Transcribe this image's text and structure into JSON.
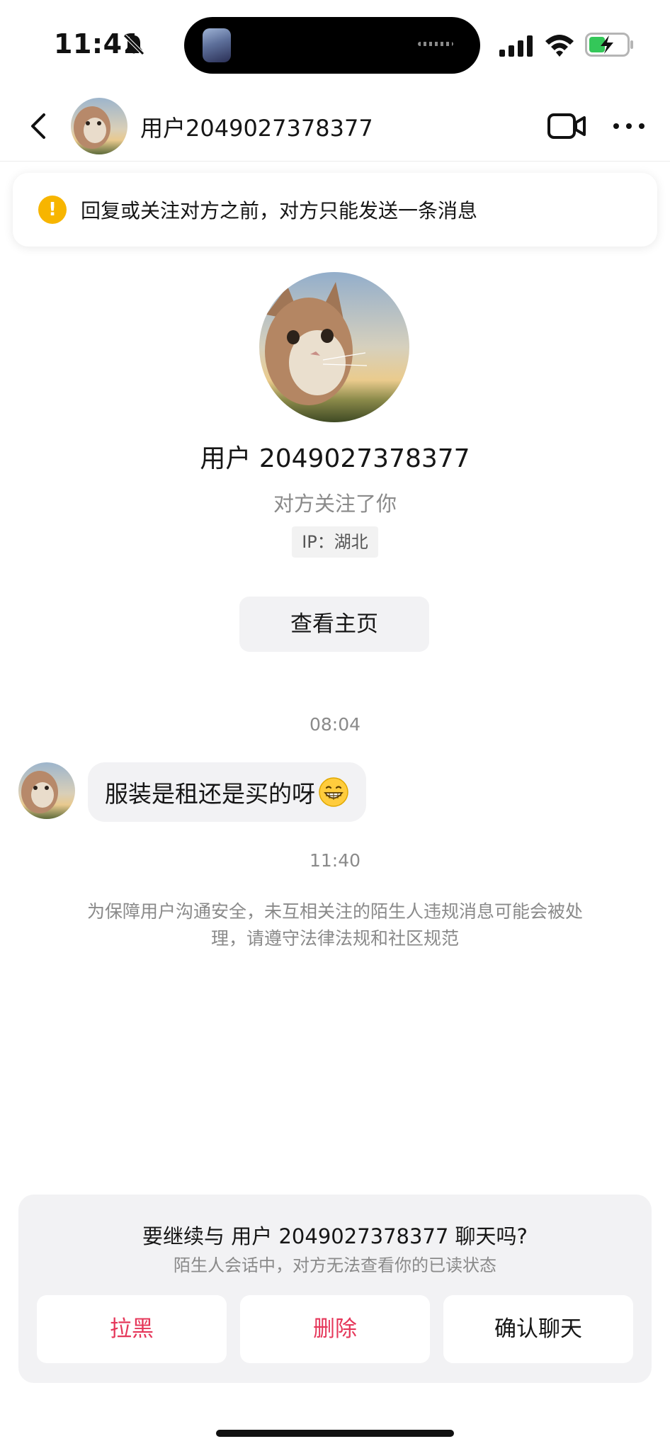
{
  "status_bar": {
    "time": "11:41",
    "icons": [
      "bell-slash-icon",
      "signal-icon",
      "wifi-icon",
      "battery-charging-icon"
    ]
  },
  "header": {
    "title": "用户2049027378377",
    "back_icon": "chevron-left-icon",
    "video_icon": "video-camera-icon",
    "more_icon": "more-dots-icon"
  },
  "notice": {
    "icon": "warning-icon",
    "text": "回复或关注对方之前，对方只能发送一条消息",
    "color": "#f7b500"
  },
  "profile": {
    "name": "用户 2049027378377",
    "relation": "对方关注了你",
    "ip": "IP：湖北",
    "view_profile_label": "查看主页"
  },
  "chat": {
    "messages": [
      {
        "time": "08:04",
        "text": "服装是租还是买的呀",
        "emoji": "grinning-face-icon"
      }
    ],
    "second_time": "11:40",
    "safety_note": "为保障用户沟通安全，未互相关注的陌生人违规消息可能会被处理，请遵守法律法规和社区规范"
  },
  "confirm_card": {
    "title": "要继续与 用户 2049027378377 聊天吗?",
    "subtitle": "陌生人会话中，对方无法查看你的已读状态",
    "buttons": {
      "block": "拉黑",
      "delete": "删除",
      "confirm": "确认聊天"
    },
    "danger_color": "#e5375a"
  }
}
